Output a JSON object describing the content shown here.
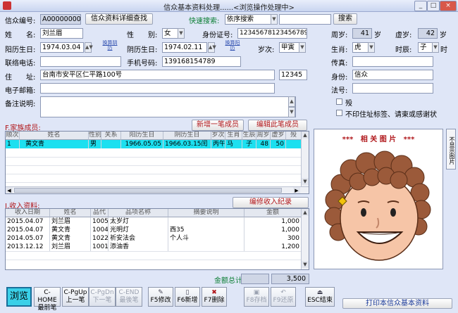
{
  "window": {
    "title": "信众基本资料处理......<浏览操作处理中>",
    "min_btn": "_",
    "max_btn": "□",
    "close_btn": "×"
  },
  "search": {
    "id_label": "信众编号:",
    "id_value": "A000000006",
    "detail_search": "信众资料详细查找",
    "quick_label": "快速搜索:",
    "quick_option": "依序搜索",
    "quick_value": "",
    "search_button": "搜索"
  },
  "form": {
    "name_label": "姓",
    "name_label2": "名:",
    "name_value": "刘兰眉",
    "gender_label": "性",
    "gender_label2": "别:",
    "gender_value": "女",
    "id_card_label": "身份证号:",
    "id_card_value": "123456781234567890",
    "age_label": "周岁:",
    "age_value": "41",
    "age_unit": "岁",
    "vage_label": "虚岁:",
    "vage_value": "42",
    "vage_unit": "岁",
    "solar_label": "阳历生日:",
    "solar_value": "1974.03.04",
    "convert_solar": "换算阴历",
    "lunar_label": "阴历生日:",
    "lunar_value": "1974.02.11",
    "convert_lunar": "换算阳历",
    "suici_label": "岁次:",
    "suici_value": "甲寅",
    "zodiac_label": "生肖:",
    "zodiac_value": "虎",
    "hour_label": "时辰:",
    "hour_value": "子",
    "hour_unit": "时",
    "phone_label": "联络电话:",
    "phone_value": "",
    "mobile_label": "手机号码:",
    "mobile_value": "139168154789",
    "fax_label": "传真:",
    "fax_value": "",
    "addr_label": "住",
    "addr_label2": "址:",
    "addr_value": "台南市安平区仁平路100号",
    "zip_value": "12345",
    "identity_label": "身份:",
    "identity_value": "信众",
    "email_label": "电子邮箱:",
    "email_value": "",
    "dharma_label": "法号:",
    "dharma_value": "",
    "note_label": "备注说明:",
    "note_value": "",
    "deceased_label": "殁",
    "no_print_label": "不印住址标签、请柬或感谢状"
  },
  "family": {
    "label": "F.家族成员:",
    "add_button": "新增一笔成员",
    "edit_button": "编辑此笔成员",
    "columns": [
      "顺次",
      "姓名",
      "性别",
      "关系",
      "阳历生日",
      "阴历生日",
      "岁次",
      "生肖",
      "生辰",
      "周岁",
      "虚岁",
      "殁"
    ],
    "rows": [
      [
        "1",
        "黄文青",
        "男",
        "",
        "1966.05.05",
        "1966.03.15闰",
        "丙午",
        "马",
        "子",
        "48",
        "50",
        ""
      ]
    ]
  },
  "picture": {
    "title": "***   相 关 图 片   ***",
    "side_tab": "不显示图片"
  },
  "income": {
    "label": "I.收入资料:",
    "edit_button": "编修收入纪录",
    "columns": [
      "收入日期",
      "姓名",
      "品代",
      "品项名称",
      "摘要说明",
      "金额"
    ],
    "rows": [
      [
        "2015.04.07",
        "刘兰眉",
        "1005",
        "太岁灯",
        "",
        "1,000"
      ],
      [
        "2015.04.07",
        "黄文青",
        "1004",
        "光明灯",
        "西35",
        "1,000"
      ],
      [
        "2014.05.07",
        "黄文青",
        "1022",
        "祈安法会",
        "个人斗",
        "300"
      ],
      [
        "2013.12.12",
        "刘兰眉",
        "1001",
        "添油香",
        "",
        "1,200"
      ]
    ],
    "total_label": "金额总计:",
    "total_blank": "",
    "total_value": "3,500"
  },
  "toolbar": {
    "browse": "浏览",
    "home": "C-HOME",
    "home2": "最前笔",
    "pgup": "C-PgUp",
    "pgup2": "上一笔",
    "pgdn": "C-PgDn",
    "pgdn2": "下一笔",
    "end": "C-END",
    "end2": "最後笔",
    "f5": "F5修改",
    "f6": "F6新增",
    "f7": "F7删除",
    "f8": "F8存档",
    "f9": "F9还原",
    "esc": "ESC结束",
    "print": "打印本信众基本资料"
  }
}
